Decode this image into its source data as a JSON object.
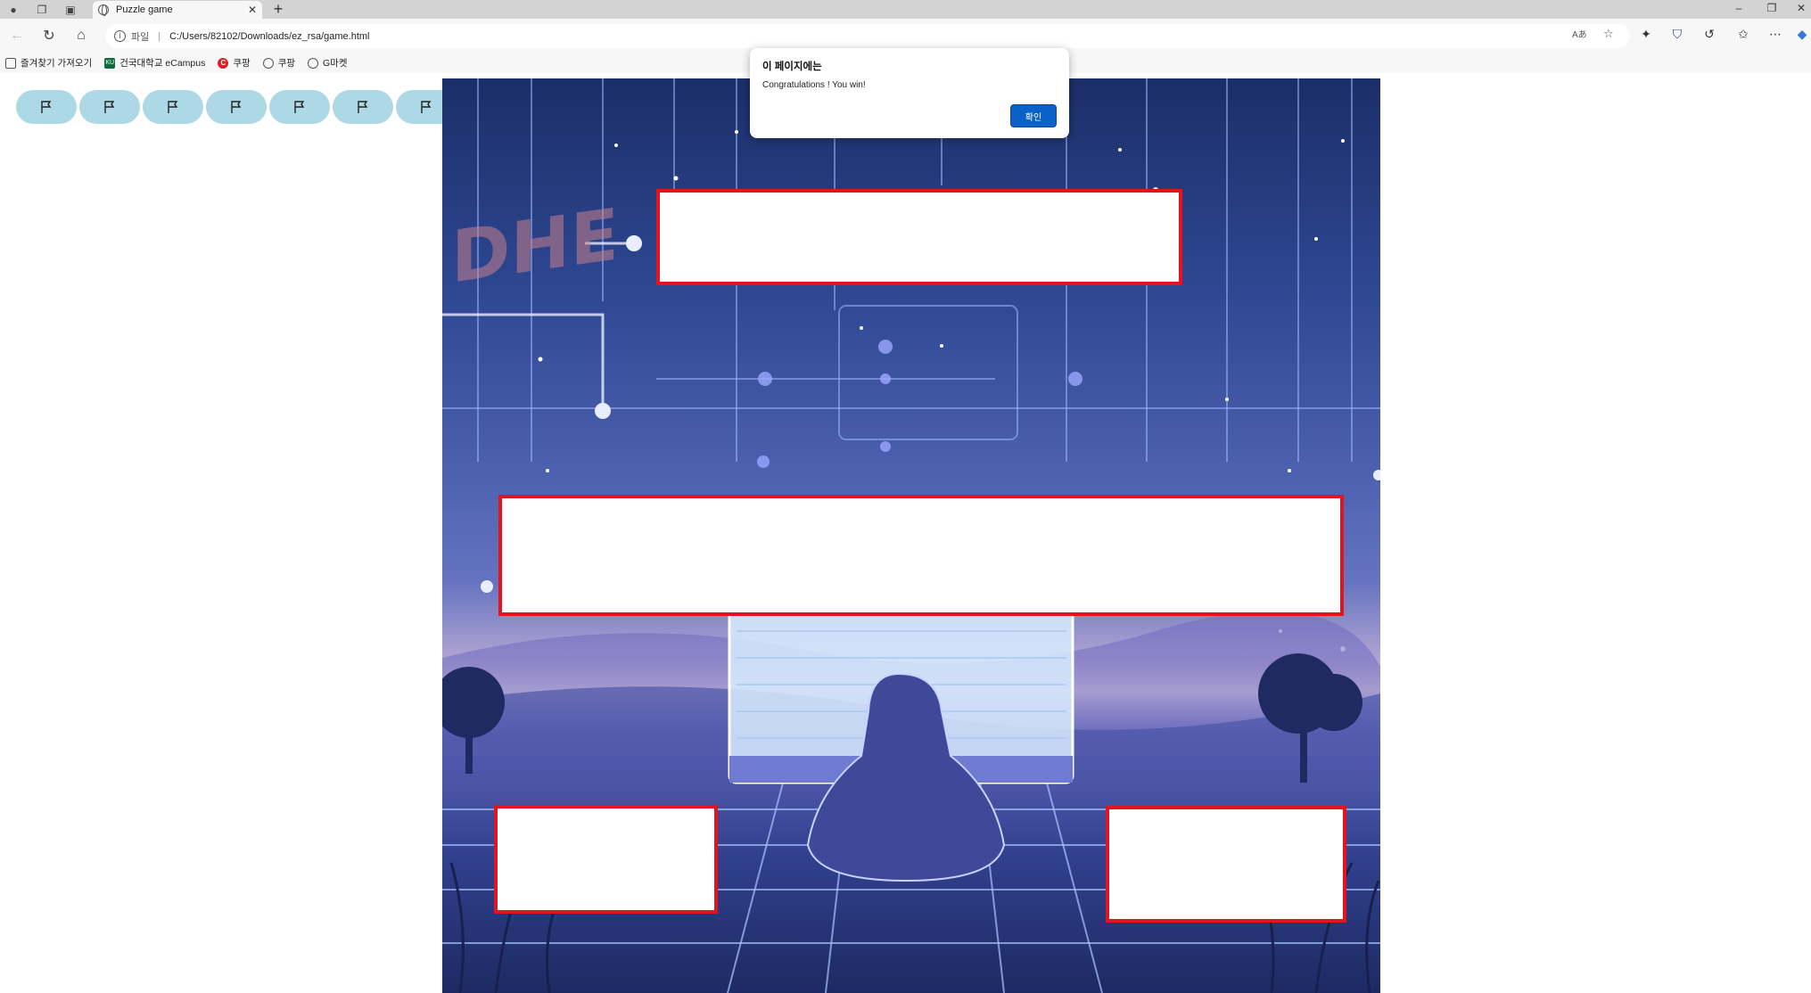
{
  "browser": {
    "tab_title": "Puzzle game",
    "tab_close": "✕",
    "new_tab": "+",
    "address": {
      "protocol_label": "파일",
      "separator": "|",
      "url": "C:/Users/82102/Downloads/ez_rsa/game.html"
    },
    "bookmarks": [
      {
        "label": "즐겨찾기 가져오기",
        "icon": "folder-icon"
      },
      {
        "label": "건국대학교 eCampus",
        "icon": "ku-logo-icon"
      },
      {
        "label": "쿠팡",
        "icon": "coupang-icon"
      },
      {
        "label": "쿠팡",
        "icon": "globe-icon"
      },
      {
        "label": "G마켓",
        "icon": "globe-icon"
      }
    ]
  },
  "page": {
    "flag_buttons": 7,
    "overlay_color": "#e3141e",
    "flag_button_color": "#add8e6"
  },
  "alert": {
    "title": "이 페이지에는",
    "message": "Congratulations ! You win!",
    "ok_label": "확인",
    "ok_color": "#0a62c9"
  }
}
